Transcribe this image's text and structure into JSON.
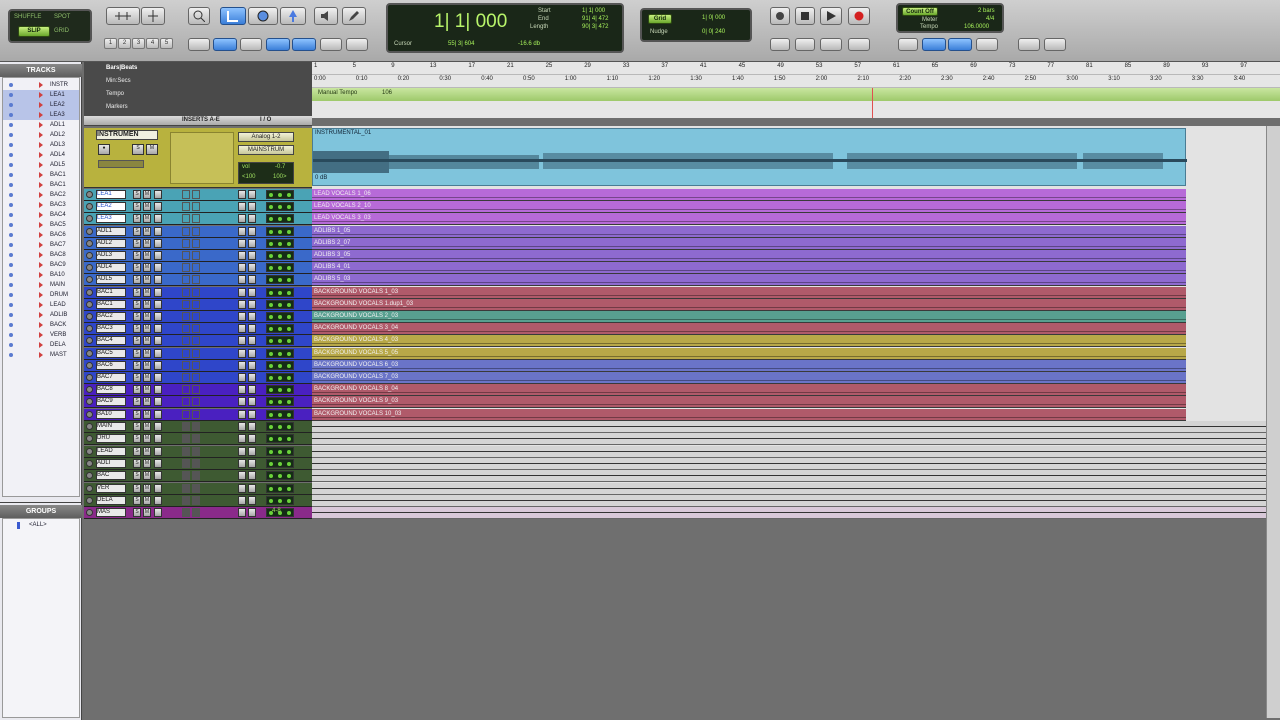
{
  "toolbar": {
    "edit_modes": {
      "shuffle": "SHUFFLE",
      "spot": "SPOT",
      "slip": "SLIP",
      "grid": "GRID"
    },
    "grid_nums": [
      "1",
      "2",
      "3",
      "4",
      "5"
    ],
    "counter": {
      "main": "1| 1| 000",
      "start_label": "Start",
      "end_label": "End",
      "length_label": "Length",
      "start": "1| 1| 000",
      "end": "91| 4| 472",
      "length": "90| 3| 472",
      "cursor_label": "Cursor",
      "cursor": "55| 3| 604",
      "level": "-16.6 db"
    },
    "grid_nudge": {
      "grid_label": "Grid",
      "grid": "1| 0| 000",
      "nudge_label": "Nudge",
      "nudge": "0| 0| 240"
    },
    "mini": {
      "countoff": "Count Off",
      "meter_label": "Meter",
      "tempo_label": "Tempo",
      "countoff_val": "2 bars",
      "meter_val": "4/4",
      "tempo_val": "106.0000"
    }
  },
  "panels": {
    "tracks": "TRACKS",
    "groups": "GROUPS",
    "all_group": "<ALL>"
  },
  "track_list": [
    "INSTR",
    "LEA1",
    "LEA2",
    "LEA3",
    "ADL1",
    "ADL2",
    "ADL3",
    "ADL4",
    "ADL5",
    "BAC1",
    "BAC1",
    "BAC2",
    "BAC3",
    "BAC4",
    "BAC5",
    "BAC6",
    "BAC7",
    "BAC8",
    "BAC9",
    "BA10",
    "MAIN",
    "DRUM",
    "LEAD",
    "ADLIB",
    "BACK",
    "VERB",
    "DELA",
    "MAST"
  ],
  "rulers": {
    "bars_beats": "Bars|Beats",
    "min_secs": "Min:Secs",
    "tempo": "Tempo",
    "markers": "Markers",
    "manual_tempo": "Manual Tempo",
    "tempo_value": "106"
  },
  "bars": [
    "1",
    "5",
    "9",
    "13",
    "17",
    "21",
    "25",
    "29",
    "33",
    "37",
    "41",
    "45",
    "49",
    "53",
    "57",
    "61",
    "65",
    "69",
    "73",
    "77",
    "81",
    "85",
    "89",
    "93",
    "97"
  ],
  "times": [
    "0:00",
    "0:10",
    "0:20",
    "0:30",
    "0:40",
    "0:50",
    "1:00",
    "1:10",
    "1:20",
    "1:30",
    "1:40",
    "1:50",
    "2:00",
    "2:10",
    "2:20",
    "2:30",
    "2:40",
    "2:50",
    "3:00",
    "3:10",
    "3:20",
    "3:30",
    "3:40"
  ],
  "columns": {
    "inserts": "INSERTS A-E",
    "io": "I / O"
  },
  "instrument_track": {
    "name": "INSTRUMEN",
    "input": "Analog 1-2",
    "output": "MAINSTRUM",
    "vol_label": "vol",
    "vol": "-0.7",
    "pan_l": "<100",
    "pan_r": "100>",
    "clip": "INSTRUMENTAL_01",
    "db": "0 dB"
  },
  "tracks": [
    {
      "name": "LEA1",
      "clip": "LEAD VOCALS 1_06",
      "color": "#4aa3b5",
      "lane": "#b76ad8",
      "sel": true
    },
    {
      "name": "LEA2",
      "clip": "LEAD VOCALS 2_10",
      "color": "#4aa3b5",
      "lane": "#b76ad8",
      "sel": true
    },
    {
      "name": "LEA3",
      "clip": "LEAD VOCALS 3_03",
      "color": "#4aa3b5",
      "lane": "#b76ad8",
      "sel": true
    },
    {
      "name": "ADL1",
      "clip": "ADLIBS 1_05",
      "color": "#3a69c9",
      "lane": "#8e6ad0",
      "sel": false
    },
    {
      "name": "ADL2",
      "clip": "ADLIBS 2_07",
      "color": "#3a69c9",
      "lane": "#8e6ad0",
      "sel": false
    },
    {
      "name": "ADL3",
      "clip": "ADLIBS 3_05",
      "color": "#3a69c9",
      "lane": "#8e6ad0",
      "sel": false
    },
    {
      "name": "ADL4",
      "clip": "ADLIBS 4_01",
      "color": "#3a69c9",
      "lane": "#8e6ad0",
      "sel": false
    },
    {
      "name": "ADL5",
      "clip": "ADLIBS 5_03",
      "color": "#3a69c9",
      "lane": "#8e6ad0",
      "sel": false
    },
    {
      "name": "BAC1",
      "clip": "BACKGROUND VOCALS 1_03",
      "color": "#2f46c9",
      "lane": "#b05a6a",
      "sel": false
    },
    {
      "name": "BAC1",
      "clip": "BACKGROUND VOCALS 1.dup1_03",
      "color": "#2f46c9",
      "lane": "#b05a6a",
      "sel": false
    },
    {
      "name": "BAC2",
      "clip": "BACKGROUND VOCALS 2_03",
      "color": "#2f46c9",
      "lane": "#58a090",
      "sel": false
    },
    {
      "name": "BAC3",
      "clip": "BACKGROUND VOCALS 3_04",
      "color": "#2f46c9",
      "lane": "#b05a6a",
      "sel": false
    },
    {
      "name": "BAC4",
      "clip": "BACKGROUND VOCALS 4_03",
      "color": "#2f46c9",
      "lane": "#b8a848",
      "sel": false
    },
    {
      "name": "BAC5",
      "clip": "BACKGROUND VOCALS 5_05",
      "color": "#2f46c9",
      "lane": "#b8a848",
      "sel": false
    },
    {
      "name": "BAC6",
      "clip": "BACKGROUND VOCALS 6_03",
      "color": "#2f46c9",
      "lane": "#6a74c8",
      "sel": false
    },
    {
      "name": "BAC7",
      "clip": "BACKGROUND VOCALS 7_03",
      "color": "#2f46c9",
      "lane": "#6a74c8",
      "sel": false
    },
    {
      "name": "BAC8",
      "clip": "BACKGROUND VOCALS 8_04",
      "color": "#4a20c0",
      "lane": "#b05a6a",
      "sel": false
    },
    {
      "name": "BAC9",
      "clip": "BACKGROUND VOCALS 9_03",
      "color": "#4a20c0",
      "lane": "#b05a6a",
      "sel": false
    },
    {
      "name": "BA10",
      "clip": "BACKGROUND VOCALS 10_03",
      "color": "#4a20c0",
      "lane": "#b05a6a",
      "sel": false
    }
  ],
  "aux_tracks": [
    {
      "name": "MAIN",
      "color": "#3e5a32"
    },
    {
      "name": "DRU",
      "color": "#3e5a32"
    },
    {
      "name": "LEAD",
      "color": "#3e5a32"
    },
    {
      "name": "ADLI",
      "color": "#3e5a32"
    },
    {
      "name": "BAC",
      "color": "#3e5a32"
    },
    {
      "name": "VER",
      "color": "#3e5a32"
    },
    {
      "name": "DELA",
      "color": "#3e5a32"
    },
    {
      "name": "MAS",
      "color": "#8a2a8a"
    }
  ],
  "master_out": "4-8"
}
